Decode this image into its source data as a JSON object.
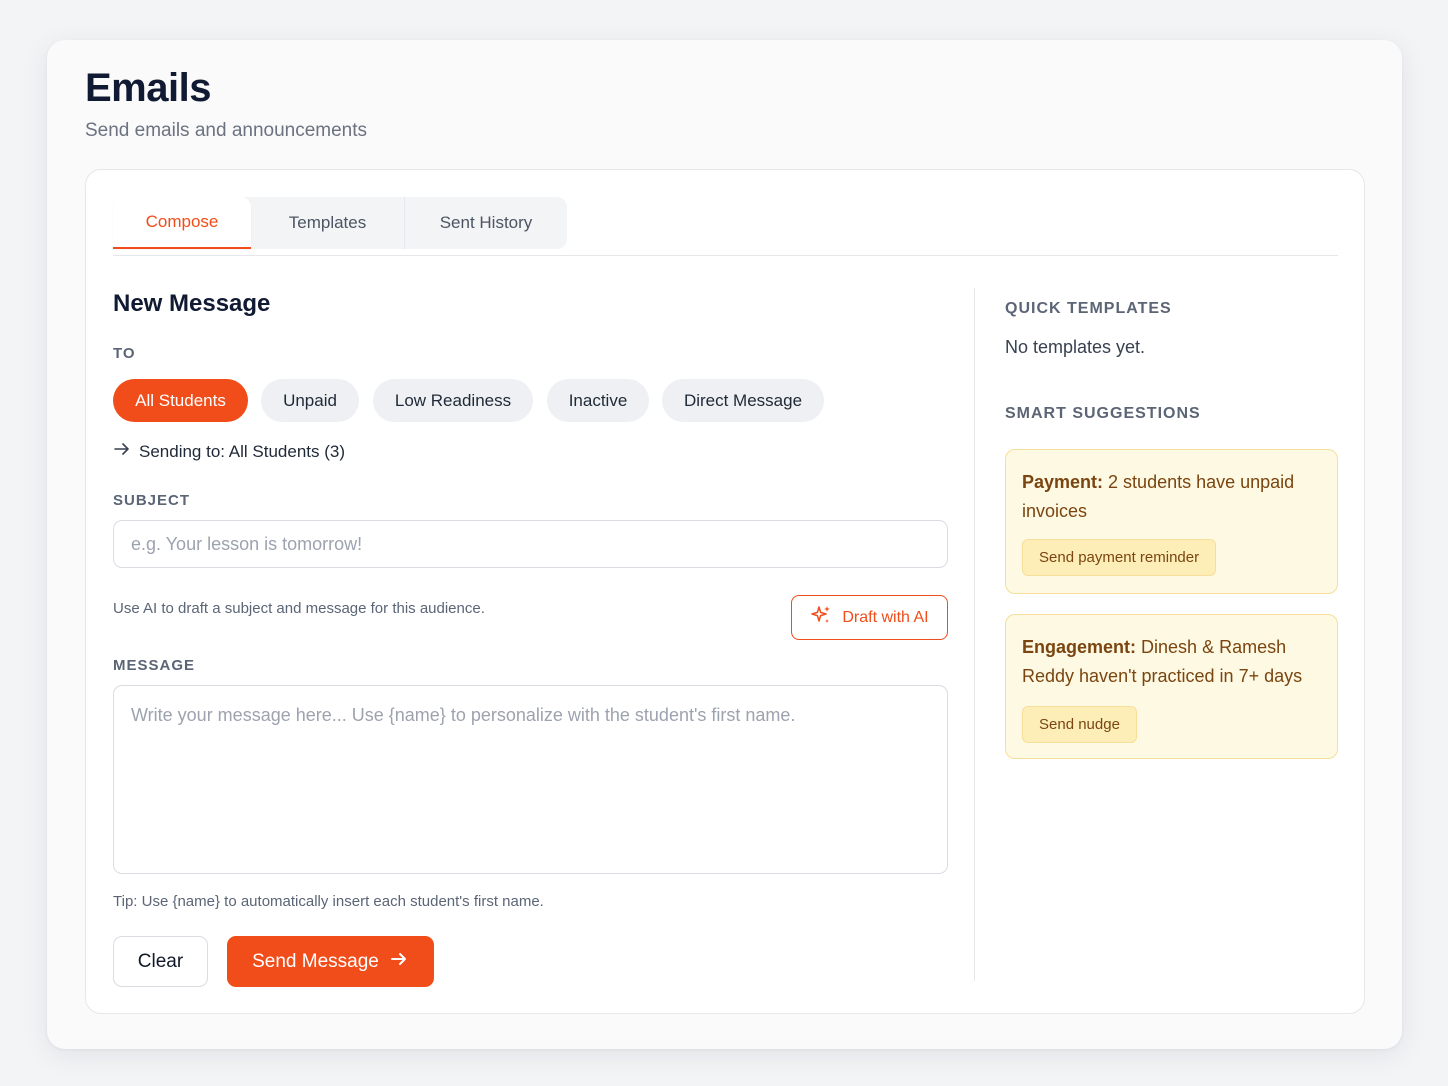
{
  "page": {
    "title": "Emails",
    "subtitle": "Send emails and announcements"
  },
  "tabs": [
    "Compose",
    "Templates",
    "Sent History"
  ],
  "active_tab": "Compose",
  "compose": {
    "title": "New Message",
    "to_label": "TO",
    "recipients": [
      "All Students",
      "Unpaid",
      "Low Readiness",
      "Inactive",
      "Direct Message"
    ],
    "selected_recipient": "All Students",
    "sending_to": "Sending to: All Students (3)",
    "subject_label": "SUBJECT",
    "subject_value": "",
    "subject_placeholder": "e.g. Your lesson is tomorrow!",
    "ai_hint": "Use AI to draft a subject and message for this audience.",
    "ai_button": "Draft with AI",
    "message_label": "MESSAGE",
    "message_value": "",
    "message_placeholder": "Write your message here... Use {name} to personalize with the student's first name.",
    "tip": "Tip: Use {name} to automatically insert each student's first name.",
    "clear_button": "Clear",
    "send_button": "Send Message"
  },
  "sidebar": {
    "quick_templates_label": "QUICK TEMPLATES",
    "quick_templates_empty": "No templates yet.",
    "smart_suggestions_label": "SMART SUGGESTIONS",
    "suggestions": [
      {
        "title": "Payment:",
        "text": "2 students have unpaid invoices",
        "action": "Send payment reminder"
      },
      {
        "title": "Engagement:",
        "text": "Dinesh & Ramesh Reddy haven't practiced in 7+ days",
        "action": "Send nudge"
      }
    ]
  },
  "colors": {
    "accent": "#f04d1a",
    "suggestion_bg": "#fef9e3",
    "suggestion_border": "#f6df9b",
    "suggestion_text": "#7a4510"
  },
  "icons": {
    "sending_arrow": "arrow-right-icon",
    "ai": "sparkle-icon",
    "send": "arrow-right-icon"
  }
}
